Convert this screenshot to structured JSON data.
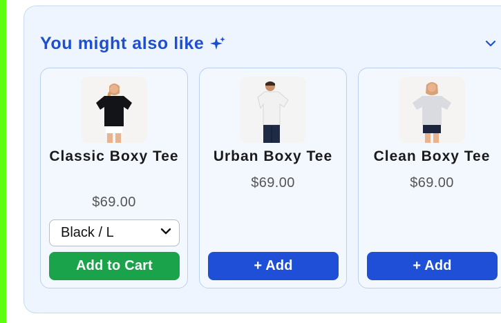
{
  "section": {
    "title": "You might also like"
  },
  "products": [
    {
      "name": "Classic Boxy Tee",
      "price": "$69.00",
      "variant": "Black / L",
      "button": "Add to Cart"
    },
    {
      "name": "Urban Boxy Tee",
      "price": "$69.00",
      "button": "+ Add"
    },
    {
      "name": "Clean Boxy Tee",
      "price": "$69.00",
      "button": "+ Add"
    }
  ],
  "icons": {
    "sparkle": "sparkle-icon",
    "collapse": "chevron-down-icon",
    "dropdown": "chevron-down-icon"
  },
  "colors": {
    "accent": "#1e4fd0",
    "add_to_cart": "#1aa34a",
    "add_button": "#1f4fd6",
    "panel_bg": "#eef5ff"
  }
}
